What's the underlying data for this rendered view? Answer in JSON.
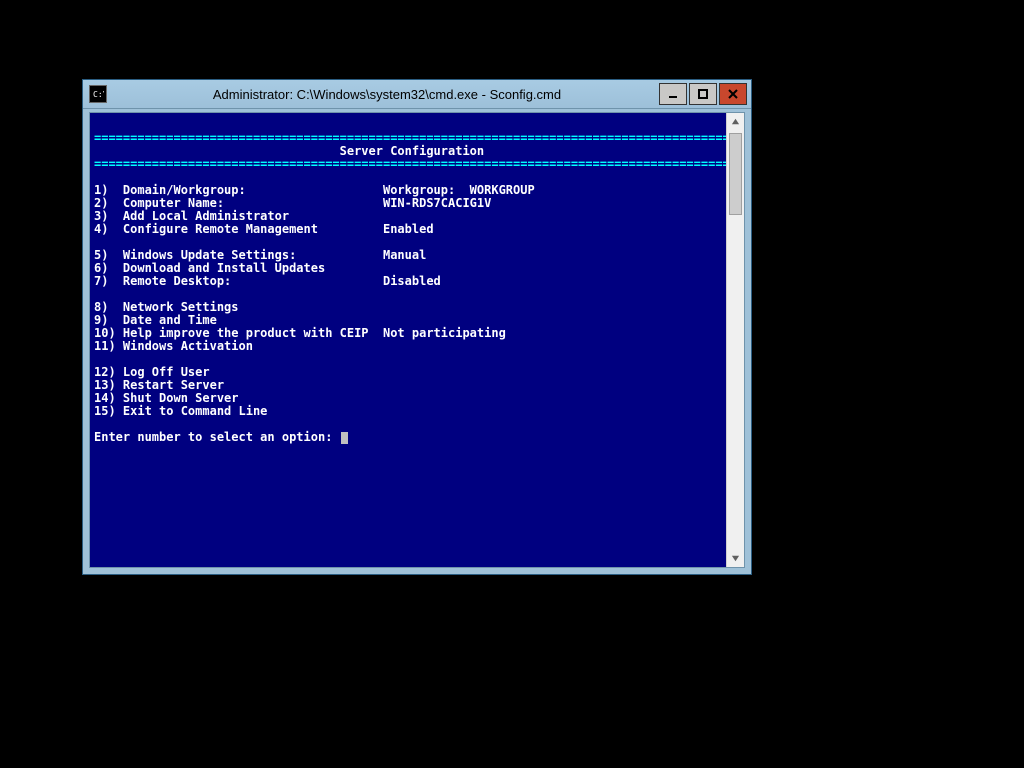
{
  "window": {
    "title": "Administrator: C:\\Windows\\system32\\cmd.exe - Sconfig.cmd"
  },
  "header": {
    "title": "Server Configuration"
  },
  "menu": [
    {
      "num": "1",
      "label": "Domain/Workgroup:",
      "value": "Workgroup:  WORKGROUP"
    },
    {
      "num": "2",
      "label": "Computer Name:",
      "value": "WIN-RDS7CACIG1V"
    },
    {
      "num": "3",
      "label": "Add Local Administrator",
      "value": ""
    },
    {
      "num": "4",
      "label": "Configure Remote Management",
      "value": "Enabled"
    },
    {
      "spacer": true
    },
    {
      "num": "5",
      "label": "Windows Update Settings:",
      "value": "Manual"
    },
    {
      "num": "6",
      "label": "Download and Install Updates",
      "value": ""
    },
    {
      "num": "7",
      "label": "Remote Desktop:",
      "value": "Disabled"
    },
    {
      "spacer": true
    },
    {
      "num": "8",
      "label": "Network Settings",
      "value": ""
    },
    {
      "num": "9",
      "label": "Date and Time",
      "value": ""
    },
    {
      "num": "10",
      "label": "Help improve the product with CEIP",
      "value": "Not participating"
    },
    {
      "num": "11",
      "label": "Windows Activation",
      "value": ""
    },
    {
      "spacer": true
    },
    {
      "num": "12",
      "label": "Log Off User",
      "value": ""
    },
    {
      "num": "13",
      "label": "Restart Server",
      "value": ""
    },
    {
      "num": "14",
      "label": "Shut Down Server",
      "value": ""
    },
    {
      "num": "15",
      "label": "Exit to Command Line",
      "value": ""
    }
  ],
  "prompt": "Enter number to select an option:"
}
